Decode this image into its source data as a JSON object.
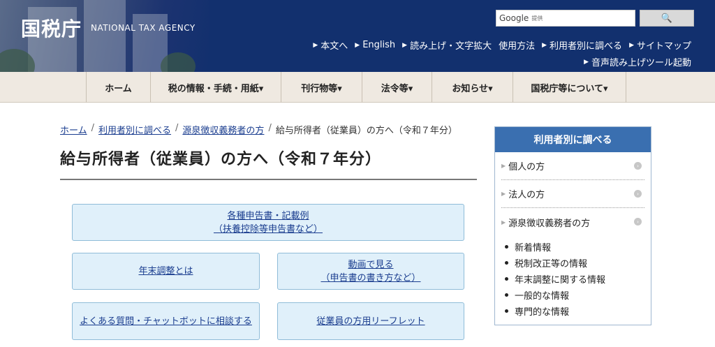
{
  "header": {
    "logo": "国税庁",
    "subtitle": "NATIONAL TAX AGENCY",
    "search": {
      "brand": "Google",
      "brand_sub": "提供",
      "button": "🔍"
    },
    "links": [
      "本文へ",
      "English",
      "読み上げ・文字拡大",
      "使用方法",
      "利用者別に調べる",
      "サイトマップ"
    ],
    "audio_link": "音声読み上げツール起動"
  },
  "nav": [
    "ホーム",
    "税の情報・手続・用紙▾",
    "刊行物等▾",
    "法令等▾",
    "お知らせ▾",
    "国税庁等について▾"
  ],
  "breadcrumb": {
    "items": [
      "ホーム",
      "利用者別に調べる",
      "源泉徴収義務者の方"
    ],
    "current": "給与所得者（従業員）の方へ（令和７年分）"
  },
  "page_title": "給与所得者（従業員）の方へ（令和７年分）",
  "buttons": {
    "forms": {
      "line1": "各種申告書・記載例",
      "line2": "（扶養控除等申告書など）"
    },
    "year_end": "年末調整とは",
    "video": {
      "line1": "動画で見る",
      "line2": "（申告書の書き方など）"
    },
    "faq": "よくある質問・チャットボットに相談する",
    "leaflet": "従業員の方用リーフレット"
  },
  "sidebar": {
    "title": "利用者別に調べる",
    "items": [
      "個人の方",
      "法人の方",
      "源泉徴収義務者の方"
    ],
    "sublist": [
      "新着情報",
      "税制改正等の情報",
      "年末調整に関する情報",
      "一般的な情報",
      "専門的な情報"
    ]
  },
  "colors": {
    "header_bg": "#12306e",
    "nav_bg": "#efe9e1",
    "button_bg": "#e0f0fa",
    "sidebar_head": "#3a6fb0",
    "link": "#1a3d8f"
  }
}
